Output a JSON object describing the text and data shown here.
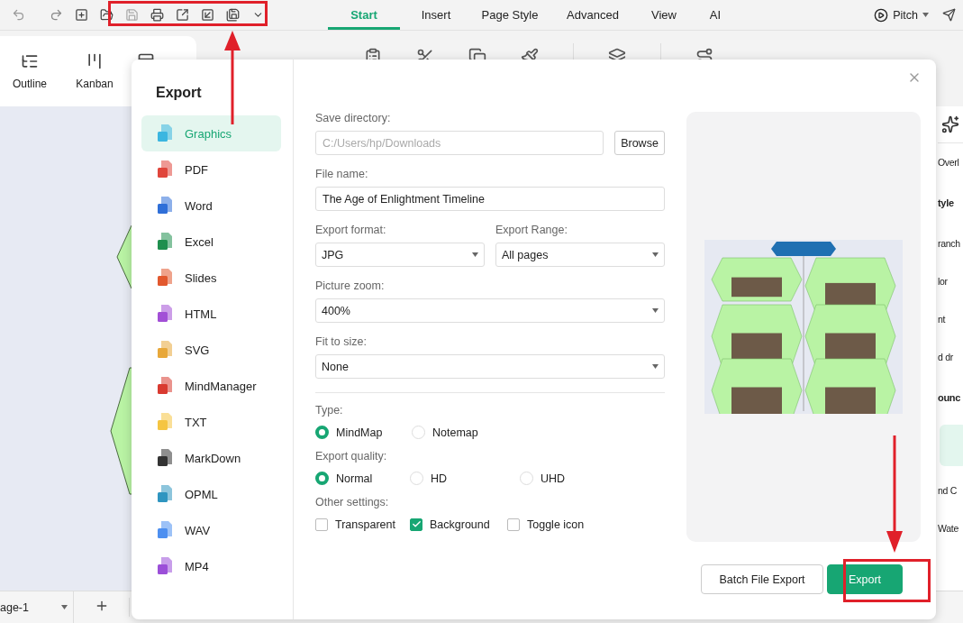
{
  "toolbar": {
    "tabs": [
      {
        "label": "Start",
        "selected": true
      },
      {
        "label": "Insert",
        "selected": false
      },
      {
        "label": "Page Style",
        "selected": false
      },
      {
        "label": "Advanced",
        "selected": false
      },
      {
        "label": "View",
        "selected": false
      },
      {
        "label": "AI",
        "selected": false
      }
    ],
    "pitch": "Pitch"
  },
  "ribbon": {
    "views": [
      "Outline",
      "Kanban"
    ]
  },
  "right_panel": {
    "items": [
      {
        "kind": "text",
        "text": "Overl"
      },
      {
        "kind": "heading",
        "text": "tyle"
      },
      {
        "kind": "text",
        "text": "ranch"
      },
      {
        "kind": "text",
        "text": "lor"
      },
      {
        "kind": "text",
        "text": "nt"
      },
      {
        "kind": "text",
        "text": "d dr"
      },
      {
        "kind": "heading",
        "text": "ounc"
      },
      {
        "kind": "text",
        "text": "nd C"
      },
      {
        "kind": "text",
        "text": "Wate"
      }
    ]
  },
  "page_bar": {
    "page": "age-1"
  },
  "dialog": {
    "title": "Export",
    "formats": [
      {
        "label": "Graphics",
        "color": "#3bb6e0",
        "selected": true
      },
      {
        "label": "PDF",
        "color": "#e0463c",
        "selected": false
      },
      {
        "label": "Word",
        "color": "#2f6fd8",
        "selected": false
      },
      {
        "label": "Excel",
        "color": "#1f8f4e",
        "selected": false
      },
      {
        "label": "Slides",
        "color": "#e2582e",
        "selected": false
      },
      {
        "label": "HTML",
        "color": "#a24fd6",
        "selected": false
      },
      {
        "label": "SVG",
        "color": "#e8a83a",
        "selected": false
      },
      {
        "label": "MindManager",
        "color": "#d93a30",
        "selected": false
      },
      {
        "label": "TXT",
        "color": "#f5c542",
        "selected": false
      },
      {
        "label": "MarkDown",
        "color": "#333333",
        "selected": false
      },
      {
        "label": "OPML",
        "color": "#2f95c0",
        "selected": false
      },
      {
        "label": "WAV",
        "color": "#4d8ff0",
        "selected": false
      },
      {
        "label": "MP4",
        "color": "#9b4fd8",
        "selected": false
      }
    ],
    "save_directory": {
      "label": "Save directory:",
      "value": "C:/Users/hp/Downloads",
      "disabled": true,
      "button": "Browse"
    },
    "file_name": {
      "label": "File name:",
      "value": "The Age of Enlightment Timeline"
    },
    "export_format": {
      "label": "Export format:",
      "value": "JPG"
    },
    "export_range": {
      "label": "Export Range:",
      "value": "All pages"
    },
    "picture_zoom": {
      "label": "Picture zoom:",
      "value": "400%"
    },
    "fit_to_size": {
      "label": "Fit to size:",
      "value": "None"
    },
    "type": {
      "label": "Type:",
      "options": [
        {
          "label": "MindMap",
          "selected": true
        },
        {
          "label": "Notemap",
          "selected": false
        }
      ]
    },
    "quality": {
      "label": "Export quality:",
      "options": [
        {
          "label": "Normal",
          "selected": true
        },
        {
          "label": "HD",
          "selected": false
        },
        {
          "label": "UHD",
          "selected": false
        }
      ]
    },
    "other": {
      "label": "Other settings:",
      "options": [
        {
          "label": "Transparent",
          "checked": false
        },
        {
          "label": "Background",
          "checked": true
        },
        {
          "label": "Toggle icon",
          "checked": false
        }
      ]
    },
    "buttons": [
      {
        "kind": "secondary",
        "label": "Batch File Export"
      },
      {
        "kind": "primary",
        "label": "Export"
      }
    ]
  }
}
